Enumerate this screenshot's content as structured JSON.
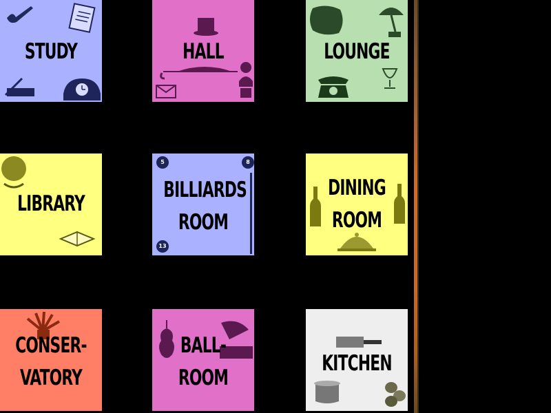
{
  "board": {
    "rooms": [
      {
        "id": "study",
        "lines": [
          "STUDY",
          ""
        ],
        "color": "#aab2ff"
      },
      {
        "id": "hall",
        "lines": [
          "HALL",
          ""
        ],
        "color": "#e070c8"
      },
      {
        "id": "lounge",
        "lines": [
          "LOUNGE",
          ""
        ],
        "color": "#b7dfb0"
      },
      {
        "id": "library",
        "lines": [
          "LIBRARY",
          ""
        ],
        "color": "#ffff80"
      },
      {
        "id": "billiards",
        "lines": [
          "BILLIARDS",
          "ROOM"
        ],
        "color": "#aab2ff"
      },
      {
        "id": "dining",
        "lines": [
          "DINING",
          "ROOM"
        ],
        "color": "#ffff80"
      },
      {
        "id": "conservatory",
        "lines": [
          "CONSER-",
          "VATORY"
        ],
        "color": "#ff7f66"
      },
      {
        "id": "ballroom",
        "lines": [
          "BALL-",
          "ROOM"
        ],
        "color": "#e070c8"
      },
      {
        "id": "kitchen",
        "lines": [
          "KITCHEN",
          ""
        ],
        "color": "#eeeeee"
      }
    ],
    "billiard_ball_numbers": [
      "5",
      "8",
      "13"
    ],
    "divider_color": "#c8682c"
  }
}
